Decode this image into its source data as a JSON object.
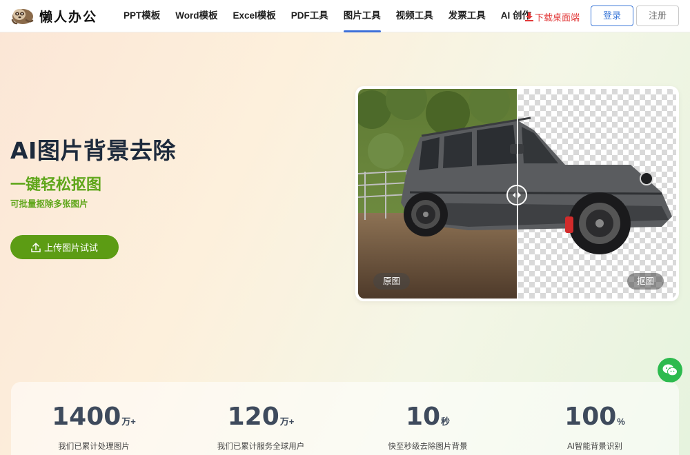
{
  "brand": {
    "name": "懒人办公"
  },
  "nav": {
    "items": [
      {
        "label": "PPT模板",
        "active": false
      },
      {
        "label": "Word模板",
        "active": false
      },
      {
        "label": "Excel模板",
        "active": false
      },
      {
        "label": "PDF工具",
        "active": false
      },
      {
        "label": "图片工具",
        "active": true
      },
      {
        "label": "视频工具",
        "active": false
      },
      {
        "label": "发票工具",
        "active": false
      },
      {
        "label": "AI 创作",
        "active": false
      }
    ],
    "download_label": "下载桌面端",
    "login_label": "登录",
    "register_label": "注册"
  },
  "hero": {
    "title": "AI图片背景去除",
    "subtitle": "一键轻松抠图",
    "note": "可批量抠除多张图片",
    "upload_label": "上传图片试试"
  },
  "compare": {
    "left_tag": "原图",
    "right_tag": "抠图"
  },
  "stats": [
    {
      "value": "1400",
      "unit": "万+",
      "label": "我们已累计处理图片"
    },
    {
      "value": "120",
      "unit": "万+",
      "label": "我们已累计服务全球用户"
    },
    {
      "value": "10",
      "unit": "秒",
      "label": "快至秒级去除图片背景"
    },
    {
      "value": "100",
      "unit": "%",
      "label": "AI智能背景识别"
    }
  ],
  "colors": {
    "accent_blue": "#3c6fd9",
    "brand_green": "#5c9c14",
    "download_red": "#e23a3a",
    "title_navy": "#1d2a3c"
  },
  "icons": {
    "logo": "sloth-logo-icon",
    "download": "download-icon",
    "upload": "upload-icon",
    "compare_handle": "compare-slider-icon",
    "chat": "wechat-icon"
  }
}
